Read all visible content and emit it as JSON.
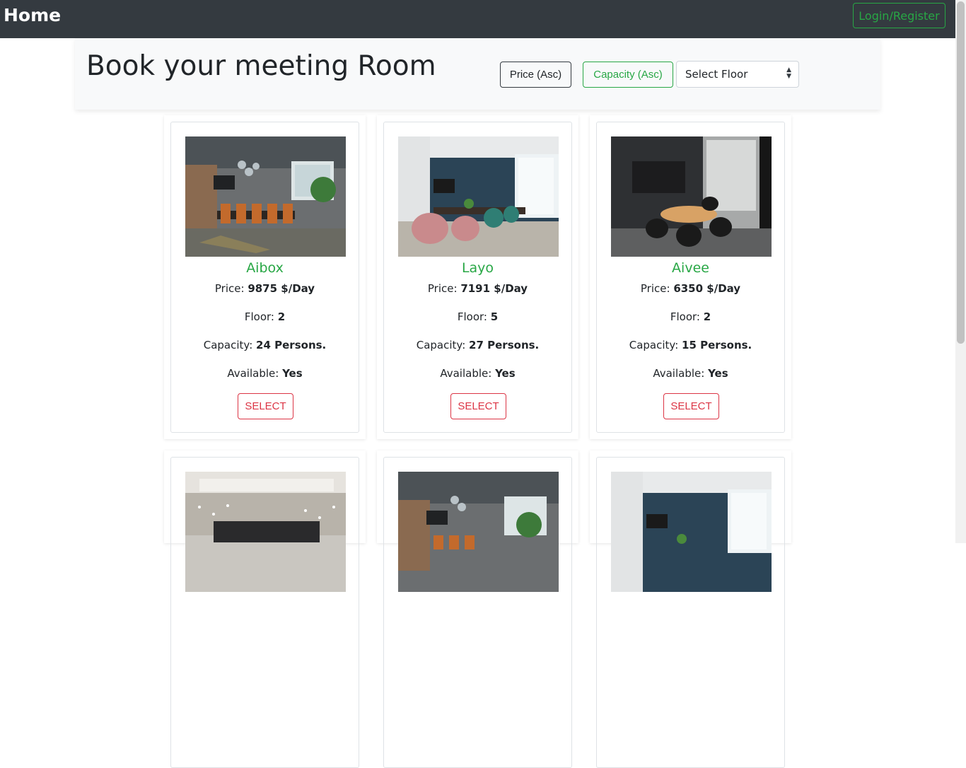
{
  "navbar": {
    "brand": "Home",
    "login_label": "Login/Register"
  },
  "header": {
    "title": "Book your meeting Room",
    "sort_price_label": "Price (Asc)",
    "sort_capacity_label": "Capacity (Asc)",
    "floor_select_value": "Select Floor"
  },
  "labels": {
    "price": "Price: ",
    "floor": "Floor: ",
    "capacity": "Capacity: ",
    "available": "Available: ",
    "select": "SELECT"
  },
  "rooms": [
    {
      "name": "Aibox",
      "price": "9875 $/Day",
      "floor": "2",
      "capacity": "24 Persons.",
      "available": "Yes",
      "image": "industrial-meeting-room-photo"
    },
    {
      "name": "Layo",
      "price": "7191 $/Day",
      "floor": "5",
      "capacity": "27 Persons.",
      "available": "Yes",
      "image": "blue-wall-meeting-room-photo"
    },
    {
      "name": "Aivee",
      "price": "6350 $/Day",
      "floor": "2",
      "capacity": "15 Persons.",
      "available": "Yes",
      "image": "round-table-meeting-room-photo"
    },
    {
      "image": "boardroom-lights-photo"
    },
    {
      "image": "industrial-meeting-room-photo"
    },
    {
      "image": "blue-wall-meeting-room-photo"
    }
  ],
  "colors": {
    "navbar": "#343a40",
    "success": "#28a745",
    "danger": "#dc3545",
    "header_bg": "#f8f9fa"
  }
}
